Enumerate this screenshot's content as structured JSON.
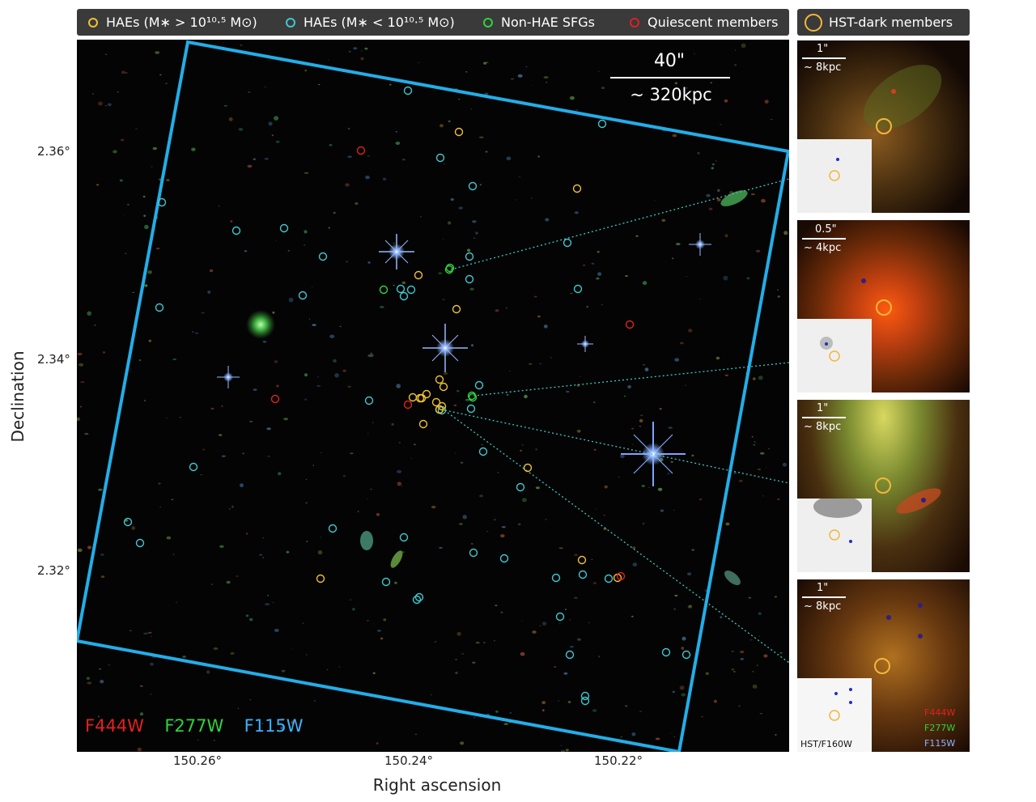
{
  "legend": {
    "hae_massive": "HAEs (M∗ > 10¹⁰·⁵ M⊙)",
    "hae_low": "HAEs (M∗ < 10¹⁰·⁵ M⊙)",
    "non_hae": "Non-HAE SFGs",
    "quiescent": "Quiescent members",
    "hst_dark": "HST-dark members"
  },
  "colors": {
    "hae_massive": "#f0c230",
    "hae_low": "#3ec8d0",
    "non_hae": "#2fd43a",
    "quiescent": "#e02020",
    "hst_dark": "#f4b63a",
    "footprint": "#22aee8"
  },
  "scale_bar": {
    "angle": "40\"",
    "distance": "~ 320kpc"
  },
  "axes": {
    "ylabel": "Declination",
    "xlabel": "Right ascension",
    "yticks": [
      "2.36°",
      "2.34°",
      "2.32°"
    ],
    "xticks": [
      "150.26°",
      "150.24°",
      "150.22°"
    ]
  },
  "filters": {
    "f444w": {
      "label": "F444W",
      "color": "#e52020"
    },
    "f277w": {
      "label": "F277W",
      "color": "#2fd43a"
    },
    "f115w": {
      "label": "F115W",
      "color": "#3ab3ff"
    }
  },
  "insets": [
    {
      "scale_angle": "1\"",
      "scale_dist": "~ 8kpc"
    },
    {
      "scale_angle": "0.5\"",
      "scale_dist": "~ 4kpc"
    },
    {
      "scale_angle": "1\"",
      "scale_dist": "~ 8kpc"
    },
    {
      "scale_angle": "1\"",
      "scale_dist": "~ 8kpc"
    }
  ],
  "inset_filters": [
    "F444W",
    "F277W",
    "F115W"
  ],
  "hst_label": "HST/F160W"
}
